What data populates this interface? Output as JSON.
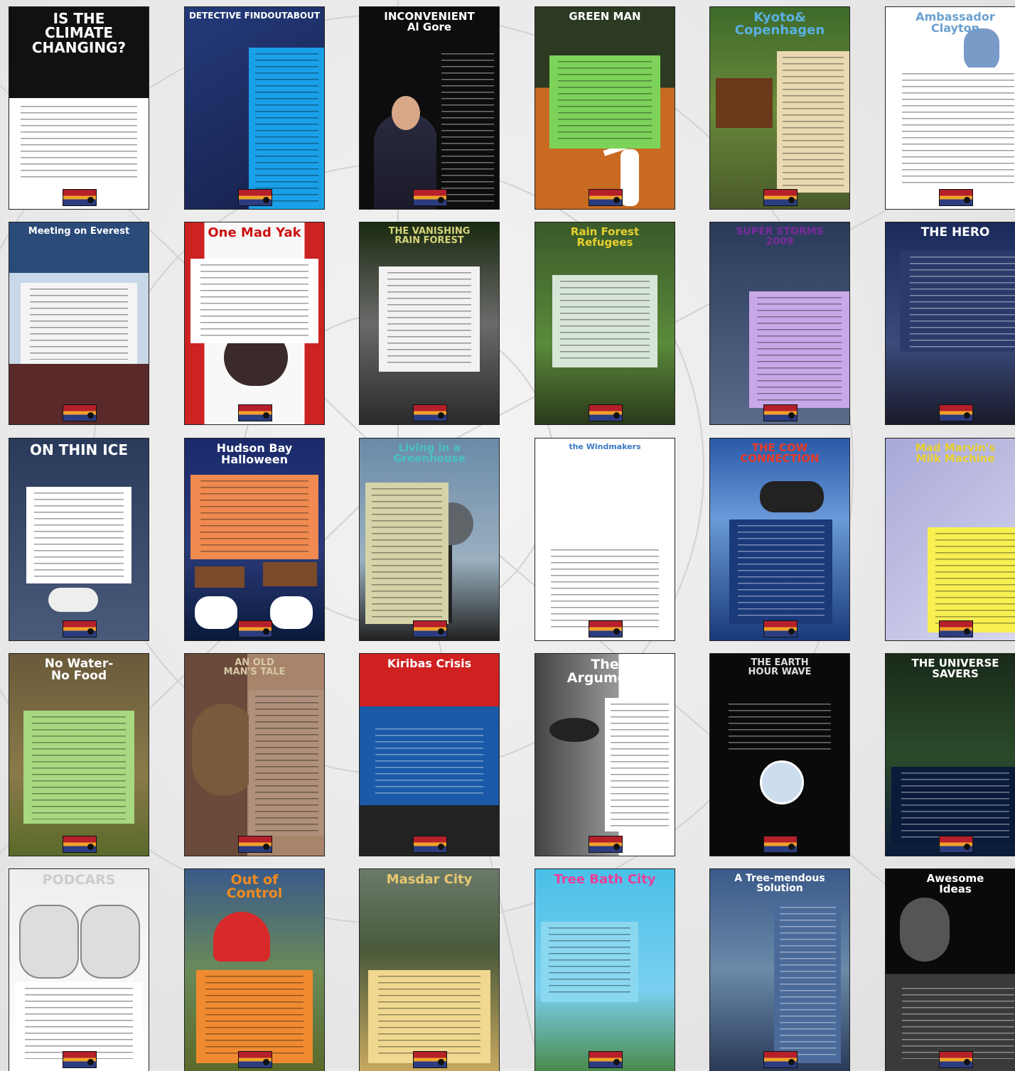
{
  "posters": [
    {
      "title": "IS THE\nCLIMATE\nCHANGING?",
      "bg": "linear-gradient(#111 0 45%,#fff 45% 100%)",
      "tc": "#ffffff",
      "fs": 20,
      "panel": [
        0,
        46,
        100,
        42,
        "#ffffff"
      ],
      "art": "word-cloud"
    },
    {
      "title": "DETECTIVE FINDOUTABOUT",
      "bg": "linear-gradient(150deg,#233a7a,#16204a)",
      "tc": "#ffffff",
      "fs": 12,
      "panel": [
        46,
        20,
        54,
        80,
        "#1aa0e8"
      ],
      "art": "windmill"
    },
    {
      "title": "INCONVENIENT\nAl Gore",
      "bg": "#0d0d0d",
      "tc": "#ffffff",
      "fs": 15,
      "panel": [
        55,
        20,
        45,
        80,
        "#0d0d0d",
        "lt"
      ],
      "art": "man-in-suit"
    },
    {
      "title": "GREEN MAN",
      "bg": "linear-gradient(#2c3a22 0 40%,#c86a22 40% 100%)",
      "tc": "#ffffff",
      "fs": 15,
      "panel": [
        10,
        24,
        80,
        46,
        "#7dd35a"
      ],
      "art": "flying-figure"
    },
    {
      "title": "Kyoto&\nCopenhagen",
      "bg": "linear-gradient(#3d6a2a,#6a8a3a 50%,#4a5a2a)",
      "tc": "#5ab0e0",
      "fs": 18,
      "panel": [
        48,
        22,
        52,
        70,
        "#e8d9b0"
      ],
      "art": "temple"
    },
    {
      "title": "Ambassador\nClayton",
      "bg": "#ffffff",
      "tc": "#6aa0d0",
      "fs": 16,
      "panel": [
        4,
        30,
        96,
        62,
        "#ffffff"
      ],
      "art": "boys"
    },
    {
      "title": "Meeting on Everest",
      "bg": "linear-gradient(#2a4a7a 0 25%,#c8d8e8 25% 70%,#5a2a2a 70%)",
      "tc": "#ffffff",
      "fs": 13,
      "panel": [
        8,
        30,
        84,
        40,
        "#f4f4f4"
      ],
      "art": "mountain"
    },
    {
      "title": "One Mad Yak",
      "bg": "linear-gradient(to right,#c22 0 14%,#f8f8f8 14% 86%,#c22 86%)",
      "tc": "#cc1111",
      "fs": 18,
      "panel": [
        4,
        18,
        92,
        42,
        "#ffffff"
      ],
      "art": "yak"
    },
    {
      "title": "THE VANISHING\nRAIN FOREST",
      "bg": "linear-gradient(#1a2a10,#6a6a6a 50%,#2a2a2a)",
      "tc": "#d4d27a",
      "fs": 13,
      "panel": [
        14,
        22,
        72,
        52,
        "#f2f2f2"
      ],
      "art": "bulldozer"
    },
    {
      "title": "Rain Forest\nRefugees",
      "bg": "linear-gradient(#3a5a2a,#5a8a3a 60%,#2a3a1a)",
      "tc": "#e8d030",
      "fs": 15,
      "panel": [
        12,
        26,
        76,
        46,
        "#d8e6d8"
      ],
      "art": "snake"
    },
    {
      "title": "SUPER STORMS\n2009",
      "bg": "linear-gradient(#2a3a5a,#5a6a8a)",
      "tc": "#7a2a9a",
      "fs": 14,
      "panel": [
        28,
        34,
        72,
        58,
        "#c8a8e8"
      ],
      "art": "storm"
    },
    {
      "title": "THE HERO",
      "bg": "linear-gradient(#1a2a5a,#3a4a7a 60%,#1a1a2a)",
      "tc": "#ffffff",
      "fs": 17,
      "panel": [
        10,
        14,
        90,
        50,
        "#2a3a6a",
        "lt"
      ],
      "art": "tree"
    },
    {
      "title": "ON THIN ICE",
      "bg": "linear-gradient(#2a3a5a,#4a5a7a)",
      "tc": "#ffffff",
      "fs": 20,
      "panel": [
        12,
        24,
        76,
        48,
        "#ffffff"
      ],
      "art": "polar-bear"
    },
    {
      "title": "Hudson Bay\nHalloween",
      "bg": "linear-gradient(#1a2a6a,#2a3a7a 55%,#0a1a3a)",
      "tc": "#ffffff",
      "fs": 16,
      "panel": [
        4,
        18,
        92,
        42,
        "#f08a50"
      ],
      "art": "polar-bears"
    },
    {
      "title": "Living in a\nGreenhouse",
      "bg": "linear-gradient(#6a8aa8,#9ab0c0 60%,#222)",
      "tc": "#4ac0c8",
      "fs": 15,
      "panel": [
        4,
        22,
        60,
        70,
        "#d4d4a8"
      ],
      "art": "smokestack"
    },
    {
      "title": "the Windmakers",
      "bg": "#ffffff",
      "tc": "#3a7ac0",
      "fs": 11,
      "panel": [
        4,
        52,
        92,
        44,
        "#ffffff"
      ],
      "art": "wind-face"
    },
    {
      "title": "THE COW\nCONNECTION",
      "bg": "linear-gradient(#2a5aa8,#6a9ad8 40%,#1a3a7a)",
      "tc": "#e83a2a",
      "fs": 15,
      "panel": [
        14,
        40,
        74,
        52,
        "#1a3a7a",
        "lt"
      ],
      "art": "bull"
    },
    {
      "title": "Mad Marvin's\nMilk Machine",
      "bg": "linear-gradient(135deg,#a8a8d8,#d8d8f0)",
      "tc": "#e8d030",
      "fs": 15,
      "panel": [
        30,
        44,
        70,
        52,
        "#f8f050"
      ],
      "art": "scientist"
    },
    {
      "title": "No Water-\nNo Food",
      "bg": "linear-gradient(#6a5a3a,#8a7a4a 60%,#5a6a2a)",
      "tc": "#ffffff",
      "fs": 17,
      "panel": [
        10,
        28,
        80,
        56,
        "#a8d880"
      ],
      "art": "cracked-earth"
    },
    {
      "title": "AN OLD\nMAN'S TALE",
      "bg": "linear-gradient(to right,#6a4a3a 0 45%,#a8856a 45%)",
      "tc": "#d8c8a8",
      "fs": 13,
      "panel": [
        46,
        18,
        54,
        72,
        "#b0907a"
      ],
      "art": "old-man"
    },
    {
      "title": "Kiribas Crisis",
      "bg": "linear-gradient(#d02020 0 26%,#1a5aa8 26% 75%,#222 75%)",
      "tc": "#ffffff",
      "fs": 16,
      "panel": [
        4,
        34,
        92,
        38,
        "#1a5aa8",
        "lt"
      ],
      "art": "waves"
    },
    {
      "title": "The\nArgument",
      "bg": "linear-gradient(to right,#444,#999 60%,#fff 60%)",
      "tc": "#ffffff",
      "fs": 19,
      "panel": [
        50,
        22,
        50,
        66,
        "#ffffff"
      ],
      "art": "eye"
    },
    {
      "title": "THE EARTH\nHOUR WAVE",
      "bg": "#0a0a0a",
      "tc": "#dddddd",
      "fs": 13,
      "panel": [
        6,
        22,
        88,
        30,
        "#0a0a0a",
        "lt"
      ],
      "art": "clock"
    },
    {
      "title": "THE UNIVERSE\nSAVERS",
      "bg": "linear-gradient(#1a2a1a,#2a4a2a 50%,#0a1a3a)",
      "tc": "#ffffff",
      "fs": 15,
      "panel": [
        4,
        56,
        92,
        38,
        "#0a1a3a",
        "lt"
      ],
      "art": "space"
    },
    {
      "title": "PODCARS",
      "bg": "linear-gradient(#eeeeee,#ffffff)",
      "tc": "#cccccc",
      "fs": 19,
      "panel": [
        4,
        56,
        92,
        40,
        "#ffffff"
      ],
      "art": "podcars"
    },
    {
      "title": "Out of\nControl",
      "bg": "linear-gradient(#3a5a8a,#6a8a5a 50%,#5a6a2a)",
      "tc": "#f08a20",
      "fs": 19,
      "panel": [
        8,
        50,
        84,
        46,
        "#f08a30"
      ],
      "art": "train"
    },
    {
      "title": "Masdar City",
      "bg": "linear-gradient(#6a7a6a,#4a5a3a 40%,#c8a860)",
      "tc": "#e8c870",
      "fs": 18,
      "panel": [
        6,
        50,
        88,
        46,
        "#f0d890"
      ],
      "art": "city"
    },
    {
      "title": "Tree Bath City",
      "bg": "linear-gradient(#4ac0e8,#7ad0f0 60%,#4a8a4a)",
      "tc": "#e8409a",
      "fs": 18,
      "panel": [
        4,
        26,
        70,
        40,
        "#8ad8f0"
      ],
      "art": "towers"
    },
    {
      "title": "A Tree-mendous\nSolution",
      "bg": "linear-gradient(#3a5a8a,#6a8aa8 50%,#2a3a5a)",
      "tc": "#ffffff",
      "fs": 14,
      "panel": [
        46,
        16,
        48,
        80,
        "#4a6a9a",
        "lt"
      ],
      "art": "stump"
    },
    {
      "title": "Awesome\nIdeas",
      "bg": "linear-gradient(#0a0a0a 0 52%,#3a3a3a 52%)",
      "tc": "#ffffff",
      "fs": 15,
      "panel": [
        4,
        56,
        96,
        40,
        "#3a3a3a",
        "lt"
      ],
      "art": "child"
    }
  ]
}
